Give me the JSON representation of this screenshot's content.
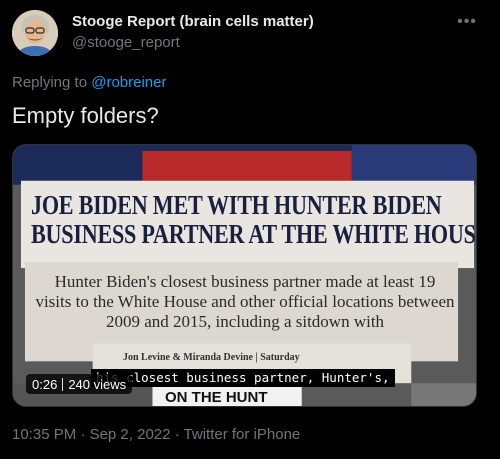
{
  "author": {
    "display_name": "Stooge Report (brain cells matter)",
    "handle": "@stooge_report",
    "avatar_icon": "avatar-portrait"
  },
  "more_icon": "more-options-icon",
  "reply": {
    "prefix": "Replying to",
    "to": "@robreiner"
  },
  "text": "Empty folders?",
  "media": {
    "headline_line1": "JOE BIDEN MET WITH HUNTER BIDEN",
    "headline_line2": "BUSINESS PARTNER AT THE WHITE HOUSE",
    "body": "Hunter Biden's closest business partner made at least 19 visits to the White House and other official locations between 2009 and 2015, including a sitdown with",
    "byline": "Jon Levine & Miranda Devine | Saturday",
    "caption": "his closest business partner, Hunter's,",
    "lower_third": "ON THE HUNT",
    "duration": "0:26",
    "views": "240 views"
  },
  "footer": {
    "time": "10:35 PM",
    "separator": " · ",
    "date": "Sep 2, 2022",
    "source": "Twitter for iPhone"
  },
  "colors": {
    "background": "#000000",
    "primary_text": "#e7e9ea",
    "secondary_text": "#71767b",
    "link": "#1d9bf0"
  }
}
